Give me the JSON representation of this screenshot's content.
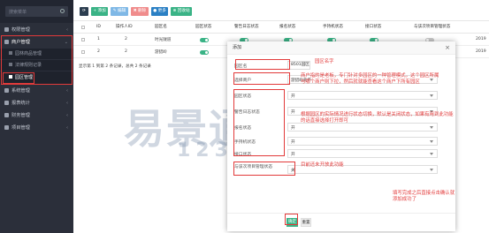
{
  "sidebar": {
    "search_placeholder": "搜索菜单",
    "items": [
      {
        "label": "权限管理",
        "icon": "shield-icon"
      },
      {
        "label": "商户管理",
        "icon": "store-icon"
      },
      {
        "label": "系统管理",
        "icon": "gear-icon"
      },
      {
        "label": "报表统计",
        "icon": "chart-icon"
      },
      {
        "label": "财务管理",
        "icon": "money-icon"
      },
      {
        "label": "项目管理",
        "icon": "folder-icon"
      }
    ],
    "sub_items": [
      {
        "label": "园林商品管理"
      },
      {
        "label": "法律规则记录"
      },
      {
        "label": "园区管理"
      }
    ]
  },
  "toolbar": {
    "refresh_label": "",
    "add_label": "+ 添加",
    "edit_label": "✎ 编辑",
    "delete_label": "✖ 删除",
    "more_label": "● 更多",
    "export_label": "⊕ 回收站"
  },
  "table": {
    "headers": [
      "ID",
      "操作人ID",
      "园区名",
      "园区状态",
      "警告日志状态",
      "报名状态",
      "手持机状态",
      "接口状态",
      "与该次项目管理状态"
    ],
    "rows": [
      {
        "id": "1",
        "operator": "2",
        "name": "时光隧道",
        "year": "2019"
      },
      {
        "id": "2",
        "operator": "2",
        "name": "游猎岭",
        "year": "2019"
      }
    ],
    "footer": "显示第 1 到第 2 条记录，总共 2 条记录"
  },
  "dialog": {
    "title": "添加",
    "fields": [
      {
        "label": "园区名",
        "value": "8501园区"
      },
      {
        "label": "选择商户",
        "value": "游猎岭商户"
      },
      {
        "label": "园区状态",
        "value": "开"
      },
      {
        "label": "警告日志状态",
        "value": "开"
      },
      {
        "label": "报名状态",
        "value": "开"
      },
      {
        "label": "手持机状态",
        "value": "开"
      },
      {
        "label": "接口状态",
        "value": "开"
      },
      {
        "label": "与该次项目管理状态",
        "value": "关"
      }
    ],
    "ok_label": "确定",
    "reset_label": "重置"
  },
  "annotations": {
    "park_name": "园区名字",
    "merchant_note": "商户指的是老板，专门针对多园区的一种管理模式，这个园区所属与哪个商户则下拉，然后就就能查看这个商户下所有园区",
    "status_note": "根据园区的实际情况进行状态切换，默认是关闭状态，如果有用到此功能的话直接选择打开即可",
    "dev_note": "目前还未开放此功能",
    "submit_note": "填写完成之后直接点击确认就添加成功了"
  },
  "watermark": {
    "line1": "易景通",
    "line2": "1230T.COM"
  },
  "colors": {
    "accent": "#3ab386",
    "annotation": "#e23a3a",
    "sidebar_bg": "#2b2f3a"
  }
}
